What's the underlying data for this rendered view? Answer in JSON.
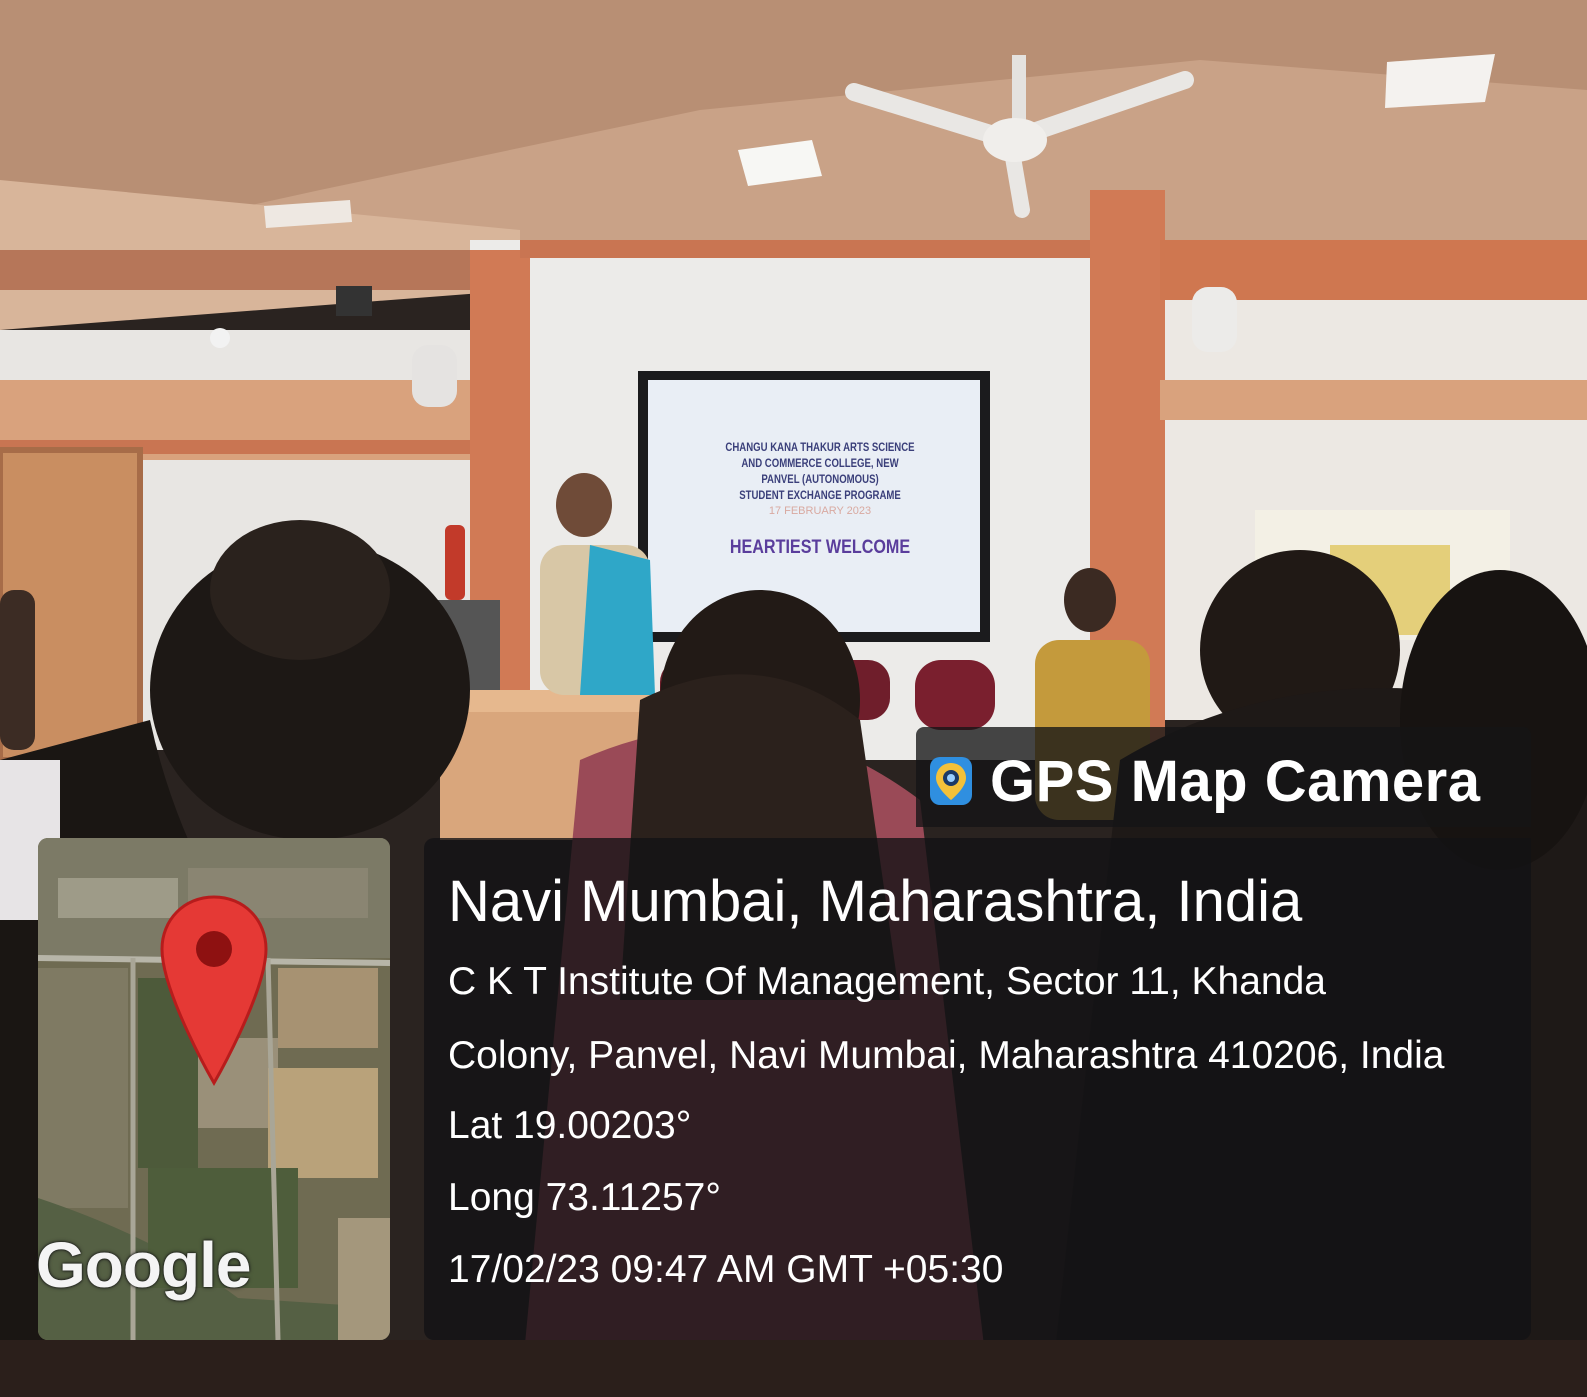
{
  "photo": {
    "screen_text": {
      "line1": "CHANGU KANA THAKUR ARTS SCIENCE",
      "line2": "AND COMMERCE COLLEGE, NEW",
      "line3": "PANVEL (AUTONOMOUS)",
      "line4": "STUDENT EXCHANGE PROGRAME",
      "date": "17 FEBRUARY 2023",
      "welcome": "HEARTIEST WELCOME"
    }
  },
  "overlay": {
    "app_name": "GPS Map Camera",
    "location_title": "Navi Mumbai, Maharashtra, India",
    "address_line1": "C K T Institute Of Management, Sector 11, Khanda",
    "address_line2": "Colony, Panvel, Navi Mumbai, Maharashtra 410206, India",
    "latitude": "Lat 19.00203°",
    "longitude": "Long 73.11257°",
    "timestamp": "17/02/23 09:47 AM GMT +05:30",
    "map_brand": "Google",
    "colors": {
      "pin": "#e53935",
      "panel": "#141416"
    }
  },
  "icons": {
    "app": "gps-map-camera-icon",
    "pin": "map-pin-icon"
  }
}
